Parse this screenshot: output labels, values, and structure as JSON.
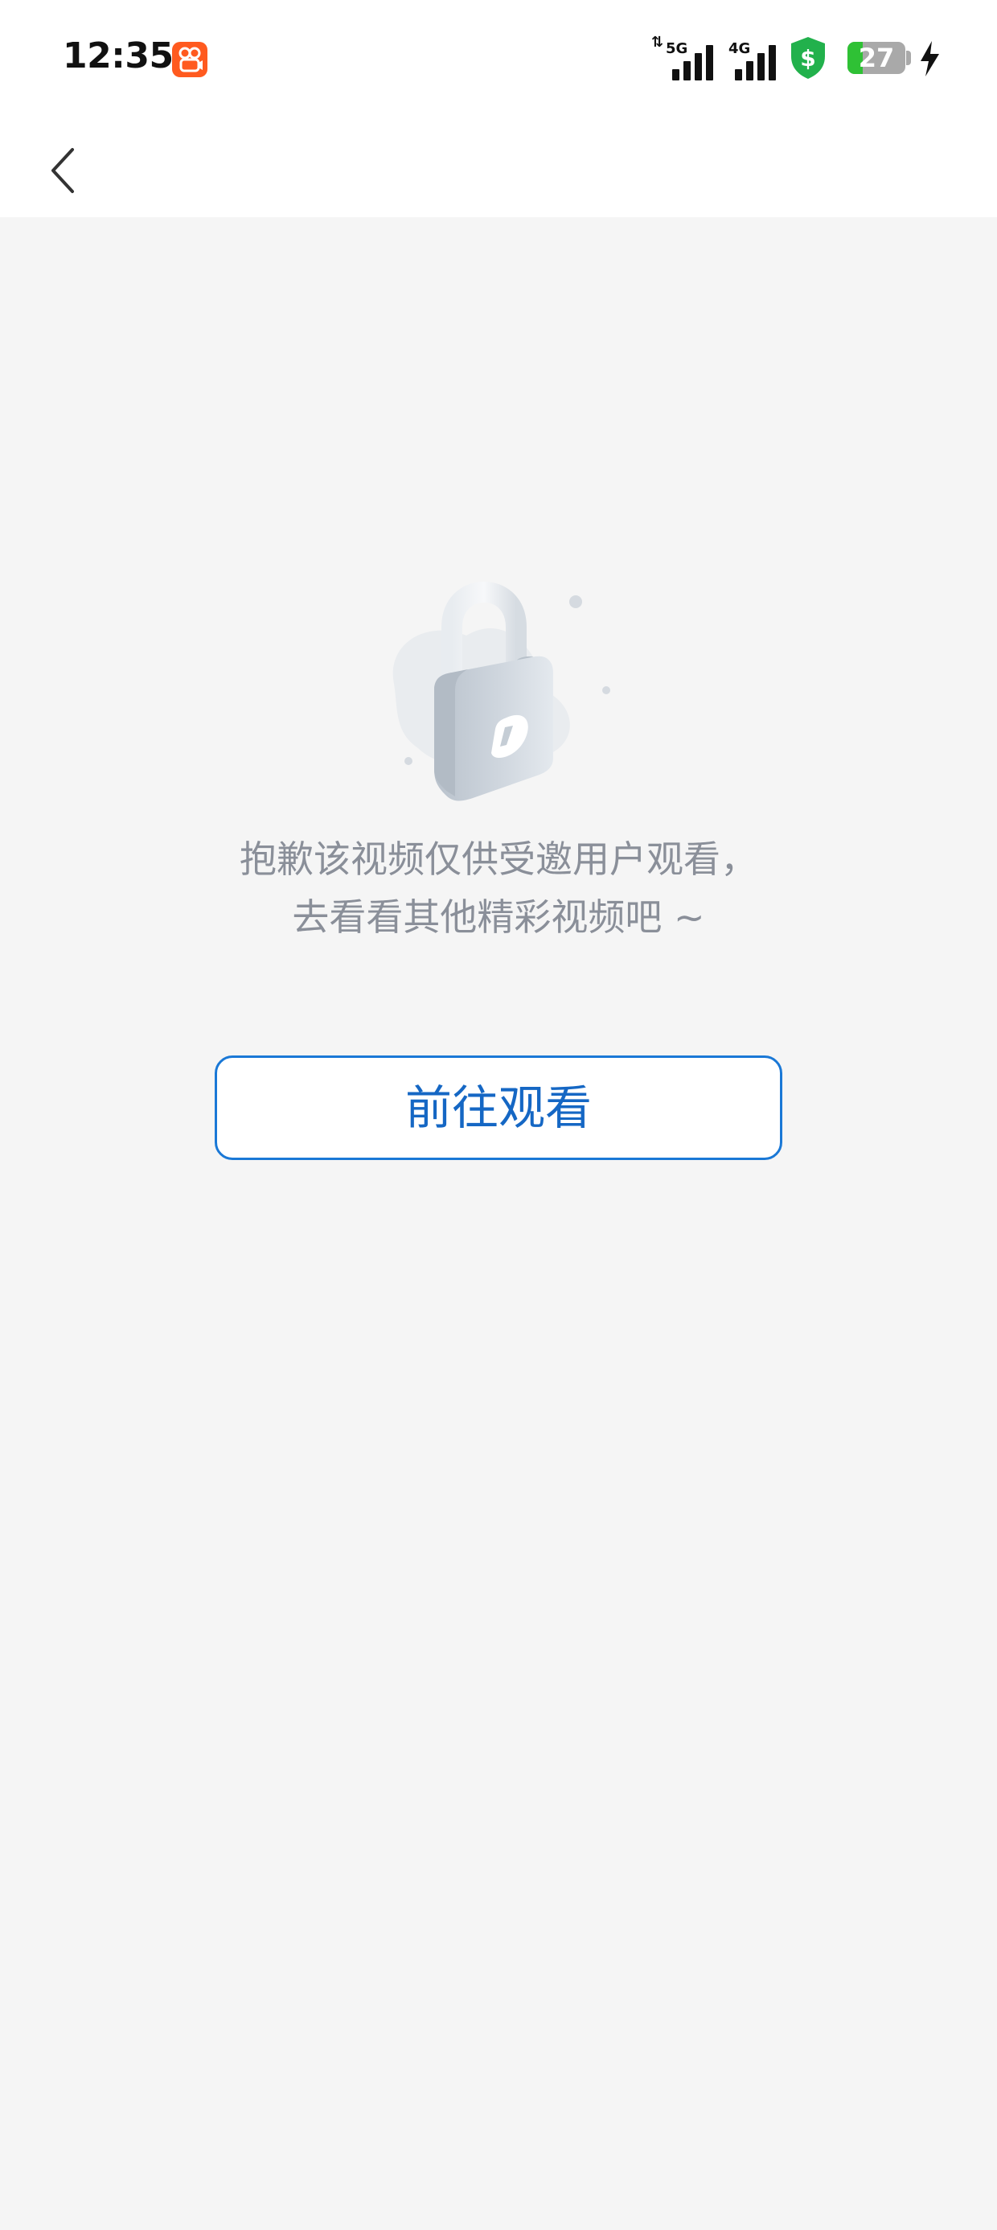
{
  "status_bar": {
    "time": "12:35",
    "network_1": "5G",
    "network_2": "4G",
    "battery_level": "27",
    "battery_fraction": 0.27,
    "accent_colors": {
      "app_badge": "#ff5a1f",
      "shield": "#22b14c",
      "battery_fill": "#2fc135"
    },
    "icons": {
      "app_badge": "app-notification-icon",
      "shield": "security-shield-icon",
      "charging": "charging-bolt-icon"
    }
  },
  "nav": {
    "back_icon": "back-arrow-icon"
  },
  "empty_state": {
    "illustration": "padlock-icon",
    "message_line1": "抱歉该视频仅供受邀用户观看，",
    "message_line2": "去看看其他精彩视频吧 ~"
  },
  "actions": {
    "go_watch_label": "前往观看",
    "accent_color": "#1a78d6"
  }
}
